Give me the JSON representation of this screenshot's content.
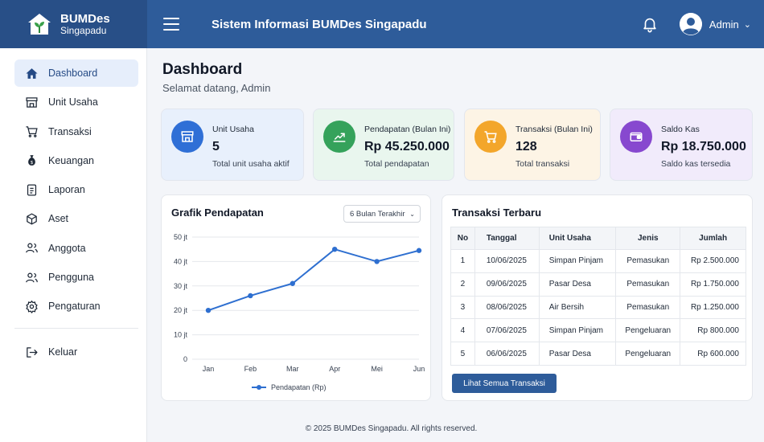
{
  "brand": {
    "name": "BUMDes",
    "sub": "Singapadu"
  },
  "header": {
    "title": "Sistem Informasi BUMDes Singapadu",
    "user": "Admin"
  },
  "sidebar": {
    "items": [
      {
        "label": "Dashboard",
        "icon": "home-icon"
      },
      {
        "label": "Unit Usaha",
        "icon": "store-icon"
      },
      {
        "label": "Transaksi",
        "icon": "cart-icon"
      },
      {
        "label": "Keuangan",
        "icon": "money-bag-icon"
      },
      {
        "label": "Laporan",
        "icon": "document-icon"
      },
      {
        "label": "Aset",
        "icon": "box-icon"
      },
      {
        "label": "Anggota",
        "icon": "users-icon"
      },
      {
        "label": "Pengguna",
        "icon": "user-group-icon"
      },
      {
        "label": "Pengaturan",
        "icon": "gear-icon"
      }
    ],
    "logout": "Keluar"
  },
  "page": {
    "title": "Dashboard",
    "subtitle": "Selamat datang, Admin"
  },
  "cards": [
    {
      "label": "Unit Usaha",
      "value": "5",
      "desc": "Total unit usaha aktif",
      "icon": "store-icon",
      "color": "#2f6fd6",
      "bg": "#e8f0fc"
    },
    {
      "label": "Pendapatan (Bulan Ini)",
      "value": "Rp 45.250.000",
      "desc": "Total pendapatan",
      "icon": "chart-up-icon",
      "color": "#35a25b",
      "bg": "#e9f6ee"
    },
    {
      "label": "Transaksi (Bulan Ini)",
      "value": "128",
      "desc": "Total transaksi",
      "icon": "cart-icon",
      "color": "#f3a62b",
      "bg": "#fdf4e5"
    },
    {
      "label": "Saldo Kas",
      "value": "Rp 18.750.000",
      "desc": "Saldo kas tersedia",
      "icon": "wallet-icon",
      "color": "#8748cf",
      "bg": "#f1ebfb"
    }
  ],
  "chart_panel": {
    "title": "Grafik Pendapatan",
    "range": "6 Bulan Terakhir"
  },
  "chart_data": {
    "type": "line",
    "categories": [
      "Jan",
      "Feb",
      "Mar",
      "Apr",
      "Mei",
      "Jun"
    ],
    "series": [
      {
        "name": "Pendapatan (Rp)",
        "values": [
          20,
          26,
          31,
          45,
          40,
          44.5
        ],
        "color": "#2e6fd0"
      }
    ],
    "y_ticks": [
      "0",
      "10 jt",
      "20 jt",
      "30 jt",
      "40 jt",
      "50 jt"
    ],
    "ylim": [
      0,
      50
    ],
    "grid": true,
    "legend": "bottom"
  },
  "tx_panel": {
    "title": "Transaksi Terbaru",
    "columns": [
      "No",
      "Tanggal",
      "Unit Usaha",
      "Jenis",
      "Jumlah"
    ],
    "rows": [
      {
        "no": "1",
        "tanggal": "10/06/2025",
        "unit": "Simpan Pinjam",
        "jenis": "Pemasukan",
        "jumlah": "Rp 2.500.000"
      },
      {
        "no": "2",
        "tanggal": "09/06/2025",
        "unit": "Pasar Desa",
        "jenis": "Pemasukan",
        "jumlah": "Rp 1.750.000"
      },
      {
        "no": "3",
        "tanggal": "08/06/2025",
        "unit": "Air Bersih",
        "jenis": "Pemasukan",
        "jumlah": "Rp 1.250.000"
      },
      {
        "no": "4",
        "tanggal": "07/06/2025",
        "unit": "Simpan Pinjam",
        "jenis": "Pengeluaran",
        "jumlah": "Rp 800.000"
      },
      {
        "no": "5",
        "tanggal": "06/06/2025",
        "unit": "Pasar Desa",
        "jenis": "Pengeluaran",
        "jumlah": "Rp 600.000"
      }
    ],
    "button": "Lihat Semua Transaksi"
  },
  "footer": "© 2025 BUMDes Singapadu. All rights reserved."
}
